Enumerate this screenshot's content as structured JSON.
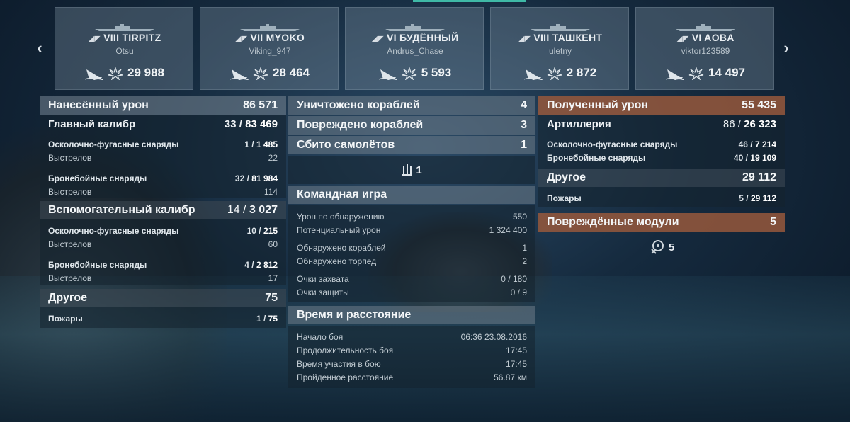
{
  "cards": [
    {
      "tier_name": "VIII TIRPITZ",
      "player": "Otsu",
      "damage": "29 988"
    },
    {
      "tier_name": "VII MYOKO",
      "player": "Viking_947",
      "damage": "28 464"
    },
    {
      "tier_name": "VI БУДЁННЫЙ",
      "player": "Andrus_Chase",
      "damage": "5 593"
    },
    {
      "tier_name": "VIII ТАШКЕНТ",
      "player": "uletny",
      "damage": "2 872"
    },
    {
      "tier_name": "VI AOBA",
      "player": "viktor123589",
      "damage": "14 497"
    }
  ],
  "nav": {
    "prev": "‹",
    "next": "›"
  },
  "left": {
    "header": {
      "label": "Нанесённый урон",
      "value": "86 571"
    },
    "main_caliber": {
      "label": "Главный калибр",
      "value_a": "33",
      "value_b": "83 469"
    },
    "mc_he": {
      "label": "Осколочно-фугасные снаряды",
      "value_a": "1",
      "value_b": "1 485"
    },
    "mc_he_shots": {
      "label": "Выстрелов",
      "value": "22"
    },
    "mc_ap": {
      "label": "Бронебойные снаряды",
      "value_a": "32",
      "value_b": "81 984"
    },
    "mc_ap_shots": {
      "label": "Выстрелов",
      "value": "114"
    },
    "secondary": {
      "label": "Вспомогательный калибр",
      "value_a": "14",
      "value_b": "3 027"
    },
    "sc_he": {
      "label": "Осколочно-фугасные снаряды",
      "value_a": "10",
      "value_b": "215"
    },
    "sc_he_shots": {
      "label": "Выстрелов",
      "value": "60"
    },
    "sc_ap": {
      "label": "Бронебойные снаряды",
      "value_a": "4",
      "value_b": "2 812"
    },
    "sc_ap_shots": {
      "label": "Выстрелов",
      "value": "17"
    },
    "other": {
      "label": "Другое",
      "value": "75"
    },
    "fires": {
      "label": "Пожары",
      "value_a": "1",
      "value_b": "75"
    }
  },
  "middle": {
    "destroyed": {
      "label": "Уничтожено кораблей",
      "value": "4"
    },
    "damaged": {
      "label": "Повреждено кораблей",
      "value": "3"
    },
    "planes": {
      "label": "Сбито самолётов",
      "value": "1"
    },
    "planes_icon_value": "1",
    "team": {
      "label": "Командная игра"
    },
    "spot_dmg": {
      "label": "Урон по обнаружению",
      "value": "550"
    },
    "potential": {
      "label": "Потенциальный урон",
      "value": "1 324 400"
    },
    "spotted_ships": {
      "label": "Обнаружено кораблей",
      "value": "1"
    },
    "spotted_torps": {
      "label": "Обнаружено торпед",
      "value": "2"
    },
    "capture": {
      "label": "Очки захвата",
      "value": "0 / 180"
    },
    "defense": {
      "label": "Очки защиты",
      "value": "0 / 9"
    },
    "time": {
      "label": "Время и расстояние"
    },
    "start": {
      "label": "Начало боя",
      "value": "06:36  23.08.2016"
    },
    "duration": {
      "label": "Продолжительность боя",
      "value": "17:45"
    },
    "participation": {
      "label": "Время участия в бою",
      "value": "17:45"
    },
    "distance": {
      "label": "Пройденное расстояние",
      "value": "56.87 км"
    }
  },
  "right": {
    "header": {
      "label": "Полученный урон",
      "value": "55 435"
    },
    "artillery": {
      "label": "Артиллерия",
      "value_a": "86",
      "value_b": "26 323"
    },
    "he": {
      "label": "Осколочно-фугасные снаряды",
      "value_a": "46",
      "value_b": "7 214"
    },
    "ap": {
      "label": "Бронебойные снаряды",
      "value_a": "40",
      "value_b": "19 109"
    },
    "other": {
      "label": "Другое",
      "value": "29 112"
    },
    "fires": {
      "label": "Пожары",
      "value_a": "5",
      "value_b": "29 112"
    },
    "modules": {
      "label": "Повреждённые модули",
      "value": "5"
    },
    "modules_icon_value": "5"
  },
  "colors": {
    "accent_top": "#3fb9a6",
    "received_header": "#96583c"
  }
}
